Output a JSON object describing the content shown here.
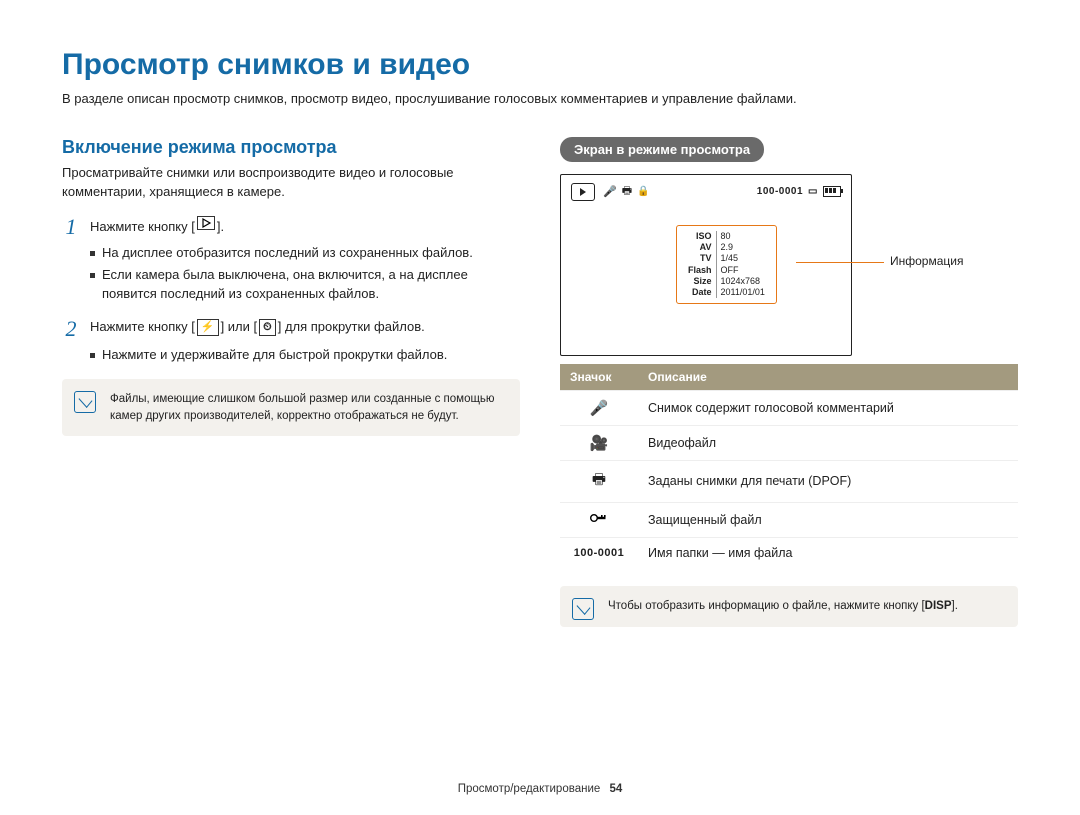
{
  "title": "Просмотр снимков и видео",
  "intro": "В разделе описан просмотр снимков, просмотр видео, прослушивание голосовых комментариев и управление файлами.",
  "left": {
    "heading": "Включение режима просмотра",
    "para": "Просматривайте снимки или воспроизводите видео и голосовые комментарии, хранящиеся в камере.",
    "step1_pre": "Нажмите кнопку [",
    "step1_post": "].",
    "step1_b1": "На дисплее отобразится последний из сохраненных файлов.",
    "step1_b2": "Если камера была выключена, она включится, а на дисплее появится последний из сохраненных файлов.",
    "step2_pre": "Нажмите кнопку [",
    "step2_mid1": "] или [",
    "step2_mid2": "] для прокрутки файлов.",
    "step2_flash": "⚡",
    "step2_timer": "⏲",
    "step2_b1": "Нажмите и удерживайте для быстрой прокрутки файлов.",
    "note": "Файлы, имеющие слишком большой размер или созданные с помощью камер других производителей, корректно отображаться не будут."
  },
  "right": {
    "pill": "Экран в режиме просмотра",
    "callout": "Информация",
    "ss": {
      "folder": "100-0001",
      "info": {
        "ISO": "80",
        "AV": "2.9",
        "TV": "1/45",
        "Flash": "OFF",
        "Size": "1024x768",
        "Date": "2011/01/01"
      }
    },
    "table": {
      "h1": "Значок",
      "h2": "Описание",
      "rows": [
        {
          "label": "Снимок содержит голосовой комментарий"
        },
        {
          "label": "Видеофайл"
        },
        {
          "label": "Заданы снимки для печати (DPOF)"
        },
        {
          "label": "Защищенный файл"
        },
        {
          "label": "Имя папки — имя файла"
        }
      ],
      "row5_icon": "100-0001"
    },
    "note_pre": "Чтобы отобразить информацию о файле, нажмите кнопку [",
    "note_btn": "DISP",
    "note_post": "]."
  },
  "footer": {
    "section": "Просмотр/редактирование",
    "page": "54"
  }
}
